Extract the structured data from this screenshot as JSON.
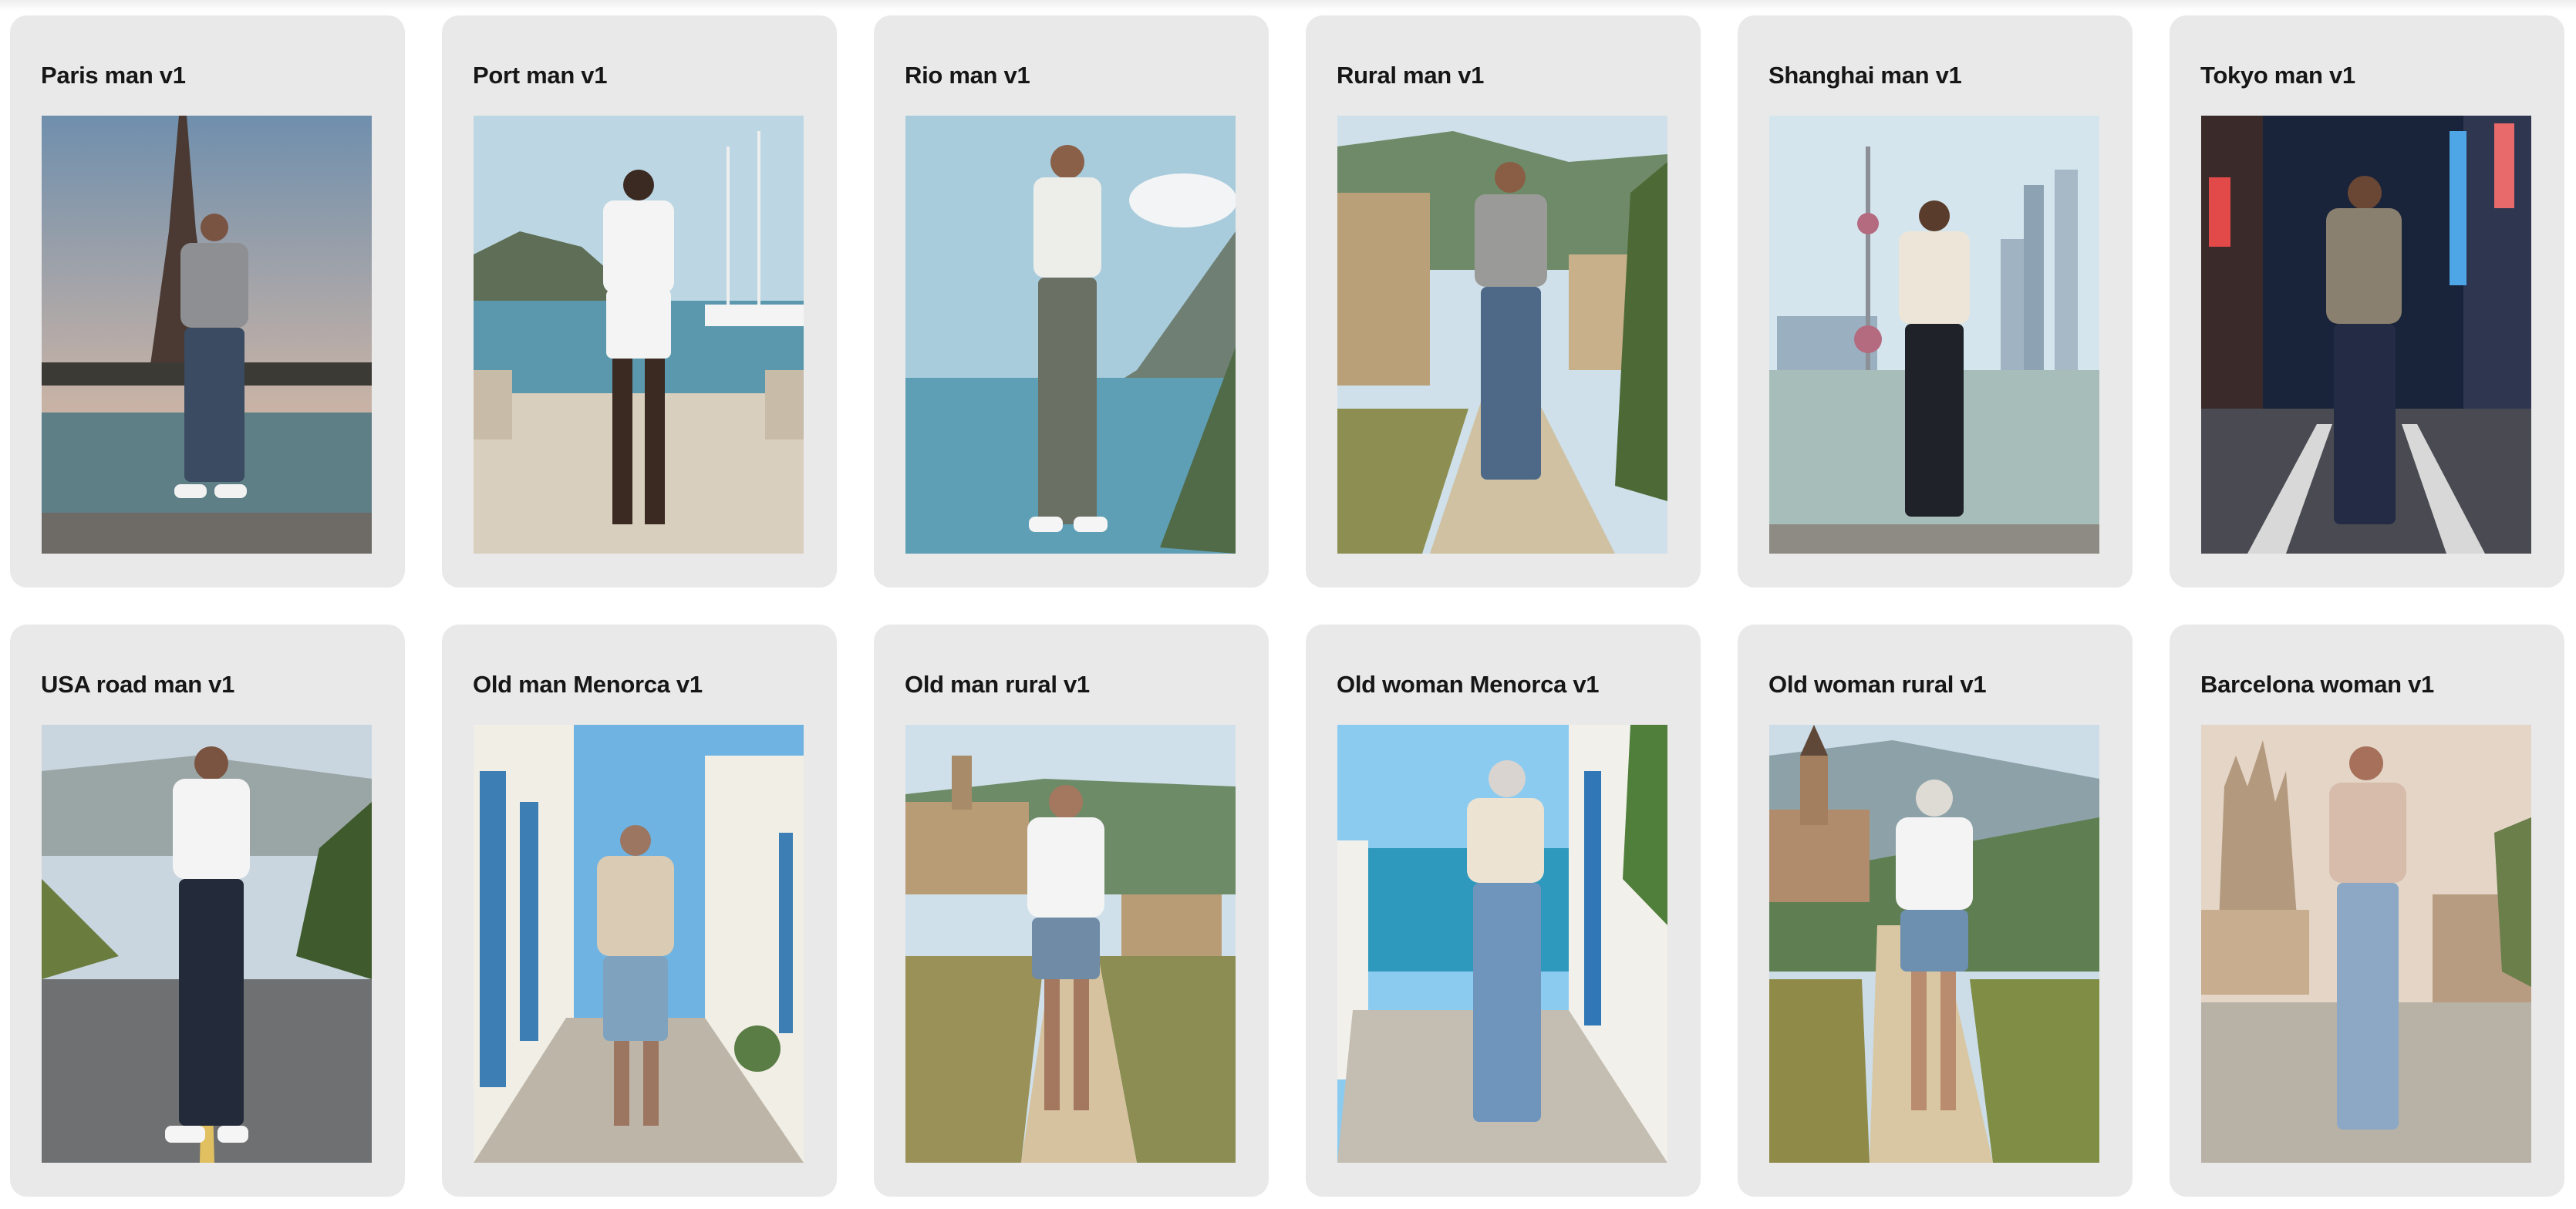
{
  "gallery": {
    "cards": [
      {
        "title": "Paris man v1",
        "scene": "paris-eiffel-tower"
      },
      {
        "title": "Port man v1",
        "scene": "harbor"
      },
      {
        "title": "Rio man v1",
        "scene": "coastal-cliffs"
      },
      {
        "title": "Rural man v1",
        "scene": "rural-village"
      },
      {
        "title": "Shanghai man v1",
        "scene": "shanghai-skyline"
      },
      {
        "title": "Tokyo man v1",
        "scene": "tokyo-street-night"
      },
      {
        "title": "USA road man v1",
        "scene": "open-road"
      },
      {
        "title": "Old man Menorca v1",
        "scene": "menorca-alley"
      },
      {
        "title": "Old man rural v1",
        "scene": "rural-path"
      },
      {
        "title": "Old woman Menorca v1",
        "scene": "menorca-seaside"
      },
      {
        "title": "Old woman rural v1",
        "scene": "rural-church-path"
      },
      {
        "title": "Barcelona woman v1",
        "scene": "barcelona-sagrada-familia"
      }
    ]
  },
  "colors": {
    "card_background": "#e9e9e9",
    "title_text": "#161616"
  }
}
